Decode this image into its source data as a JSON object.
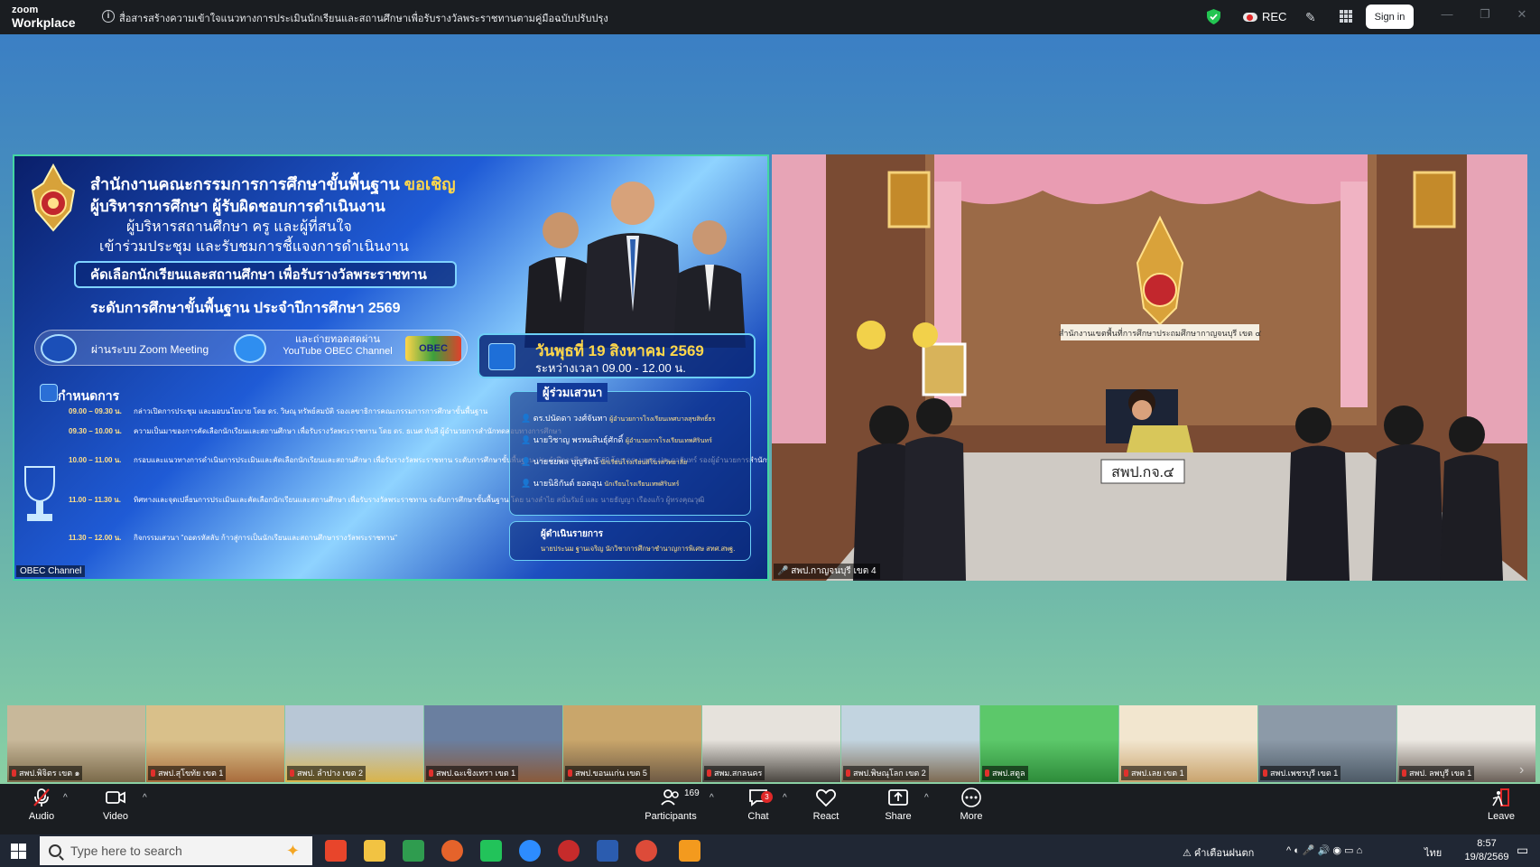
{
  "app": {
    "brand_line1": "zoom",
    "brand_line2": "Workplace"
  },
  "titlebar": {
    "meeting_topic": "สื่อสารสร้างความเข้าใจแนวทางการประเมินนักเรียนและสถานศึกษาเพื่อรับรางวัลพระราชทานตามคู่มือฉบับปรับปรุง",
    "rec_label": "REC",
    "signin_label": "Sign in",
    "minimize": "—",
    "restore": "❐",
    "close": "✕"
  },
  "shared_screen": {
    "poster": {
      "org": "สำนักงานคณะกรรมการการศึกษาขั้นพื้นฐาน",
      "invite": "ขอเชิญ",
      "line2": "ผู้บริหารการศึกษา ผู้รับผิดชอบการดำเนินงาน",
      "line3": "ผู้บริหารสถานศึกษา ครู และผู้ที่สนใจ",
      "line4": "เข้าร่วมประชุม และรับชมการชี้แจงการดำเนินงาน",
      "banner": "คัดเลือกนักเรียนและสถานศึกษา เพื่อรับรางวัลพระราชทาน",
      "level": "ระดับการศึกษาขั้นพื้นฐาน ประจำปีการศึกษา 2569",
      "via_zoom": "ผ่านระบบ Zoom Meeting",
      "via_youtube": "และถ่ายทอดสดผ่าน YouTube OBEC Channel",
      "obec_logo": "OBEC",
      "date": "วันพุธที่ 19 สิงหาคม 2569",
      "time": "ระหว่างเวลา 09.00 - 12.00 น.",
      "agenda_title": "กำหนดการ",
      "agenda": [
        {
          "time": "09.00 – 09.30 น.",
          "text": "กล่าวเปิดการประชุม และมอบนโยบาย โดย ดร. วิษณุ ทรัพย์สมบัติ รองเลขาธิการคณะกรรมการการศึกษาขั้นพื้นฐาน"
        },
        {
          "time": "09.30 – 10.00 น.",
          "text": "ความเป็นมาของการคัดเลือกนักเรียนและสถานศึกษา เพื่อรับรางวัลพระราชทาน โดย ดร. ธเนศ ทับสี ผู้อำนวยการสำนักทดสอบทางการศึกษา"
        },
        {
          "time": "10.00 – 11.00 น.",
          "text": "กรอบและแนวทางการดำเนินการประเมินและคัดเลือกนักเรียนและสถานศึกษา เพื่อรับรางวัลพระราชทาน ระดับการศึกษาขั้นพื้นฐาน ประจำปีการศึกษา 2569 โดย ดร. มยุรส ประภาจันทร์ รองผู้อำนวยการสำนักทดสอบทางการศึกษา"
        },
        {
          "time": "11.00 – 11.30 น.",
          "text": "ทิศทางและจุดเปลี่ยนการประเมินและคัดเลือกนักเรียนและสถานศึกษา เพื่อรับรางวัลพระราชทาน ระดับการศึกษาขั้นพื้นฐาน โดย นางลำไย สนั่นรัมย์ และ นายธัญญา เรืองแก้ว ผู้ทรงคุณวุฒิ"
        },
        {
          "time": "11.30 – 12.00 น.",
          "text": "กิจกรรมเสวนา \"ถอดรหัสลับ ก้าวสู่การเป็นนักเรียนและสถานศึกษารางวัลพระราชทาน\""
        }
      ],
      "panel_title": "ผู้ร่วมเสวนา",
      "panelists": [
        {
          "name": "ดร.ปนัดดา วงศ์จันทา",
          "role": "ผู้อำนวยการโรงเรียนเทศบาลสุขสิทธิ์ธร"
        },
        {
          "name": "นายวิชาญ พรหมสินธุ์ศักดิ์",
          "role": "ผู้อำนวยการโรงเรียนเทพศิรินทร์"
        },
        {
          "name": "นายชยพล บุญรัตน์",
          "role": "นักเรียนโรงเรียนสิโนรสวิทยาลัย"
        },
        {
          "name": "นายนิธิกันต์ ยอดอุน",
          "role": "นักเรียนโรงเรียนเทพศิรินทร์"
        }
      ],
      "host_title": "ผู้ดำเนินรายการ",
      "host_name": "นายประนม ฐานเจริญ นักวิชาการศึกษาชำนาญการพิเศษ สทศ.สพฐ."
    },
    "name_tag": "OBEC Channel"
  },
  "speaker": {
    "name_tag": "สพป.กาญจนบุรี เขต 4",
    "nameplate": "สพป.กจ.๔",
    "wall_sign": "สำนักงานเขตพื้นที่การศึกษาประถมศึกษากาญจนบุรี เขต ๔"
  },
  "thumbnails": [
    {
      "label": "สพป.พิจิตร เขต ๑",
      "colors": [
        "#c8b89a",
        "#7b6a4a"
      ]
    },
    {
      "label": "สพป.สุโขทัย เขต 1",
      "colors": [
        "#d9c08a",
        "#a86c3c"
      ]
    },
    {
      "label": "สพป. ลำปาง เขต 2",
      "colors": [
        "#b8c7d6",
        "#d9b44a"
      ]
    },
    {
      "label": "สพป.ฉะเชิงเทรา เขต 1",
      "colors": [
        "#6a7fa0",
        "#8a5a3a"
      ]
    },
    {
      "label": "สพป.ขอนแก่น เขต 5",
      "colors": [
        "#c9a66b",
        "#6e5a44"
      ]
    },
    {
      "label": "สพม.สกลนคร",
      "colors": [
        "#e6e2dc",
        "#4a4640"
      ]
    },
    {
      "label": "สพป.พิษณุโลก เขต 2",
      "colors": [
        "#c2d4e0",
        "#7d6a52"
      ]
    },
    {
      "label": "สพป.สตูล",
      "colors": [
        "#5cc86a",
        "#2e8c3a"
      ]
    },
    {
      "label": "สพป.เลย เขต 1",
      "colors": [
        "#f2e6cf",
        "#c9a46e"
      ]
    },
    {
      "label": "สพป.เพชรบุรี เขต 1",
      "colors": [
        "#8c9aa8",
        "#4d5a66"
      ]
    },
    {
      "label": "สพป. ลพบุรี เขต 1",
      "colors": [
        "#ece8e2",
        "#6a6058"
      ]
    }
  ],
  "toolbar": {
    "audio": "Audio",
    "video": "Video",
    "participants": "Participants",
    "participants_count": "169",
    "chat": "Chat",
    "chat_badge": "3",
    "react": "React",
    "share": "Share",
    "more": "More",
    "leave": "Leave"
  },
  "taskbar": {
    "search_placeholder": "Type here to search",
    "weather": "คำเตือนฝนตก",
    "lang": "ไทย",
    "time": "8:57",
    "date": "19/8/2569"
  },
  "colors": {
    "zoom_green_border": "#43d6a2",
    "dark_chrome": "#1a1d21",
    "muted_red": "#e02828"
  }
}
